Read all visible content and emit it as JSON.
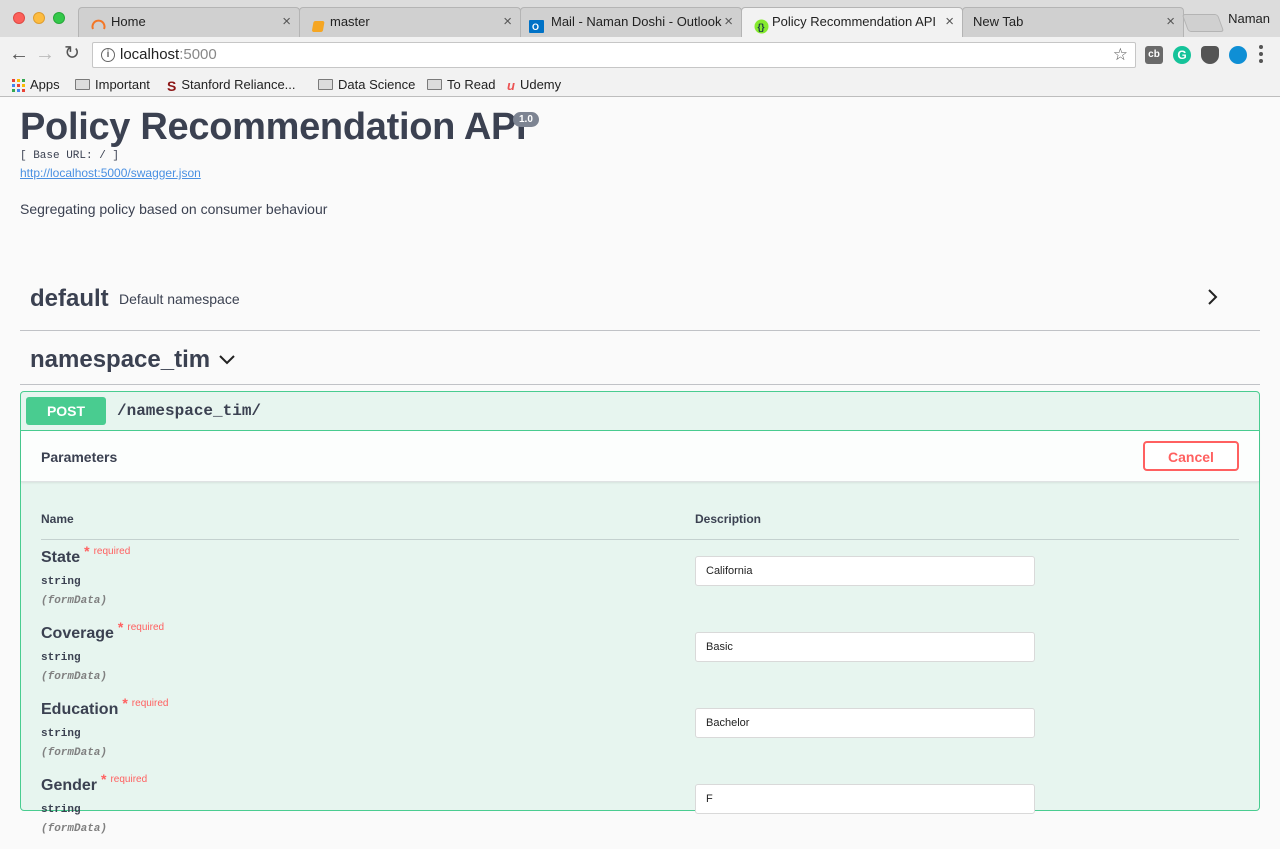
{
  "browser": {
    "tabs": [
      {
        "label": "Home",
        "active": false
      },
      {
        "label": "master",
        "active": false
      },
      {
        "label": "Mail - Naman Doshi - Outlook",
        "active": false
      },
      {
        "label": "Policy Recommendation API",
        "active": true
      },
      {
        "label": "New Tab",
        "active": false
      }
    ],
    "close_glyph": "×",
    "profile_name": "Naman",
    "address": {
      "host": "localhost",
      "port": ":5000"
    },
    "bookmarks": [
      {
        "label": "Apps",
        "icon": "apps-grid-icon"
      },
      {
        "label": "Important",
        "icon": "folder-icon"
      },
      {
        "label": "Stanford Reliance...",
        "icon": "stanford-icon"
      },
      {
        "label": "Data Science",
        "icon": "folder-icon"
      },
      {
        "label": "To Read",
        "icon": "folder-icon"
      },
      {
        "label": "Udemy",
        "icon": "udemy-icon"
      }
    ],
    "extensions": {
      "cb_label": "cb",
      "grammarly_label": "G"
    }
  },
  "page": {
    "title": "Policy Recommendation API",
    "version": "1.0",
    "base_url": "[ Base URL: / ]",
    "swagger_link": "http://localhost:5000/swagger.json",
    "description": "Segregating policy based on consumer behaviour",
    "namespaces": [
      {
        "name": "default",
        "description": "Default namespace",
        "expanded": false
      },
      {
        "name": "namespace_tim",
        "description": "",
        "expanded": true
      }
    ],
    "operation": {
      "method": "POST",
      "path": "/namespace_tim/",
      "parameters_title": "Parameters",
      "cancel_label": "Cancel",
      "columns": {
        "name": "Name",
        "description": "Description"
      },
      "parameters": [
        {
          "name": "State",
          "required_mark": "*",
          "required_label": "required",
          "type": "string",
          "in": "(formData)",
          "value": "California"
        },
        {
          "name": "Coverage",
          "required_mark": "*",
          "required_label": "required",
          "type": "string",
          "in": "(formData)",
          "value": "Basic"
        },
        {
          "name": "Education",
          "required_mark": "*",
          "required_label": "required",
          "type": "string",
          "in": "(formData)",
          "value": "Bachelor"
        },
        {
          "name": "Gender",
          "required_mark": "*",
          "required_label": "required",
          "type": "string",
          "in": "(formData)",
          "value": "F"
        }
      ]
    }
  },
  "colors": {
    "post_green": "#49cc90",
    "cancel_red": "#ff6060",
    "link_blue": "#4990e2",
    "text_dark": "#3b4151"
  }
}
